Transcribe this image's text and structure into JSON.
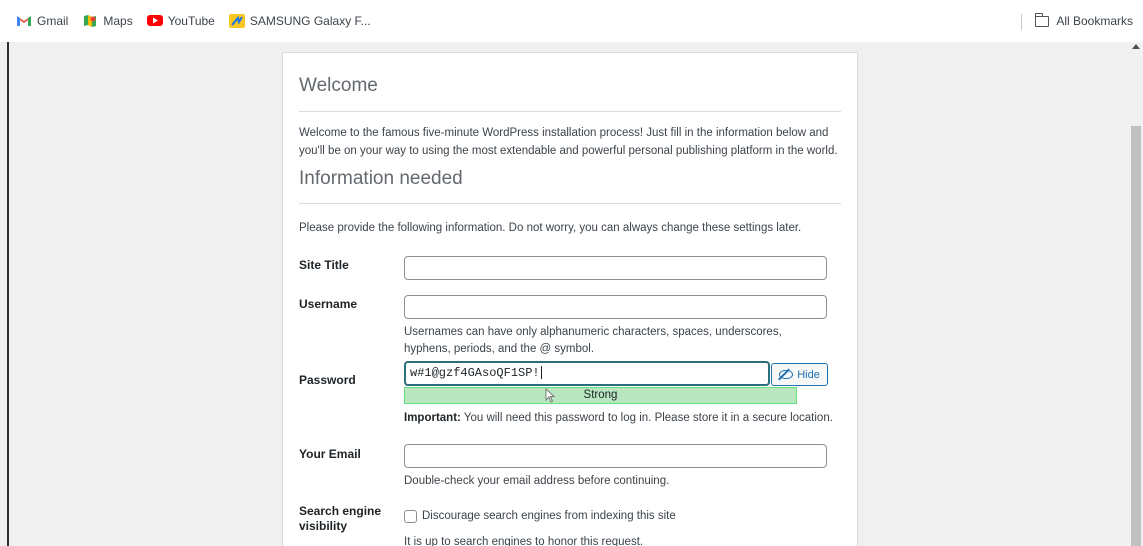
{
  "bookmarks": {
    "items": [
      {
        "label": "Gmail",
        "icon": "gmail-icon"
      },
      {
        "label": "Maps",
        "icon": "maps-icon"
      },
      {
        "label": "YouTube",
        "icon": "youtube-icon"
      },
      {
        "label": "SAMSUNG Galaxy F...",
        "icon": "samsung-icon"
      }
    ],
    "all_bookmarks": "All Bookmarks"
  },
  "install": {
    "welcome_title": "Welcome",
    "welcome_text": "Welcome to the famous five-minute WordPress installation process! Just fill in the information below and you'll be on your way to using the most extendable and powerful personal publishing platform in the world.",
    "info_title": "Information needed",
    "info_text": "Please provide the following information. Do not worry, you can always change these settings later.",
    "site_title_label": "Site Title",
    "site_title_value": "",
    "username_label": "Username",
    "username_value": "",
    "username_desc": "Usernames can have only alphanumeric characters, spaces, underscores, hyphens, periods, and the @ symbol.",
    "password_label": "Password",
    "password_value": "w#1@gzf4GAsoQF1SP!",
    "hide_label": "Hide",
    "strength_label": "Strong",
    "important_label": "Important:",
    "important_text": " You will need this password to log in. Please store it in a secure location.",
    "email_label": "Your Email",
    "email_value": "",
    "email_desc": "Double-check your email address before continuing.",
    "search_label": "Search engine visibility",
    "search_checkbox_label": "Discourage search engines from indexing this site",
    "search_desc": "It is up to search engines to honor this request."
  },
  "colors": {
    "accent": "#2271b1",
    "strength_bg": "#b8e6bf",
    "focus_border": "#2c6e7a"
  }
}
